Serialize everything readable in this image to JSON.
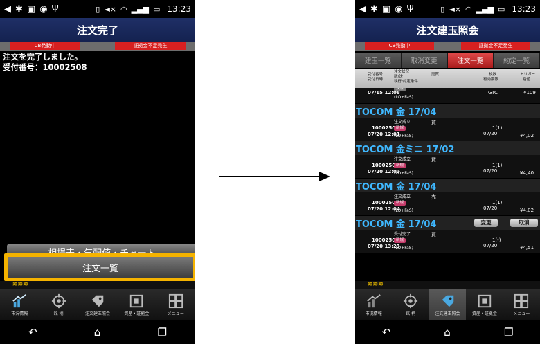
{
  "left_screen": {
    "statusbar": {
      "clock": "13:23"
    },
    "title": "注文完了",
    "alerts": [
      "CB発動中",
      "証拠金不足発生"
    ],
    "message_line1": "注文を完了しました。",
    "message_line2": "受付番号：10002508",
    "button_chart": "相場表・気配値・チャート",
    "button_list": "注文一覧",
    "bottom_tabs": [
      {
        "label": "市況情報",
        "icon": "market-chart-icon"
      },
      {
        "label": "銘 柄",
        "icon": "target-icon"
      },
      {
        "label": "注文建玉照会",
        "icon": "tag-icon"
      },
      {
        "label": "資産・証拠金",
        "icon": "safe-icon"
      },
      {
        "label": "メニュー",
        "icon": "grid-menu-icon"
      }
    ]
  },
  "right_screen": {
    "statusbar": {
      "clock": "13:23"
    },
    "title": "注文建玉照会",
    "alerts": [
      "CB発動中",
      "証拠金不足発生"
    ],
    "tabs": [
      "建玉一覧",
      "取消変更",
      "注文一覧",
      "約定一覧"
    ],
    "active_tab": "注文一覧",
    "columns": {
      "c1a": "受付番号",
      "c1b": "受付日時",
      "c2a": "注文状況",
      "c2b": "新/決",
      "c2c": "執行/約定条件",
      "c3": "売買",
      "c4a": "枚数",
      "c4b": "有効期限",
      "c5a": "トリガー",
      "c5b": "指値"
    },
    "partial_row": {
      "time": "07/15 12:08",
      "badge": "決済",
      "cond": "(LO+FaS)",
      "expiry": "GTC",
      "price": "¥109"
    },
    "orders": [
      {
        "symbol": "TOCOM 金 17/04",
        "number": "10002505",
        "time": "07/20 12:01",
        "status": "注文成立",
        "badge": "新規",
        "cond": "(LO+FaS)",
        "side": "買",
        "qty": "1(1)",
        "expiry": "07/20",
        "price": "¥4,02"
      },
      {
        "symbol": "TOCOM 金ミニ 17/02",
        "number": "10002506",
        "time": "07/20 12:03",
        "status": "注文成立",
        "badge": "新規",
        "cond": "(LO+FaS)",
        "side": "買",
        "qty": "1(1)",
        "expiry": "07/20",
        "price": "¥4,40"
      },
      {
        "symbol": "TOCOM 金 17/04",
        "number": "10002507",
        "time": "07/20 12:04",
        "status": "注文成立",
        "badge": "新規",
        "cond": "(LO+FaS)",
        "side": "売",
        "qty": "1(1)",
        "expiry": "07/20",
        "price": "¥4,02"
      },
      {
        "symbol": "TOCOM 金 17/04",
        "number": "10002508",
        "time": "07/20 13:23",
        "status": "受付完了",
        "badge": "新規",
        "cond": "(LO+FaS)",
        "side": "買",
        "qty": "1(-)",
        "expiry": "07/20",
        "price": "¥4,51",
        "change_label": "変更",
        "cancel_label": "取消"
      }
    ],
    "bottom_tabs": [
      {
        "label": "市況情報",
        "icon": "market-chart-icon"
      },
      {
        "label": "銘 柄",
        "icon": "target-icon"
      },
      {
        "label": "注文建玉照会",
        "icon": "tag-icon"
      },
      {
        "label": "資産・証拠金",
        "icon": "safe-icon"
      },
      {
        "label": "メニュー",
        "icon": "grid-menu-icon"
      }
    ]
  }
}
